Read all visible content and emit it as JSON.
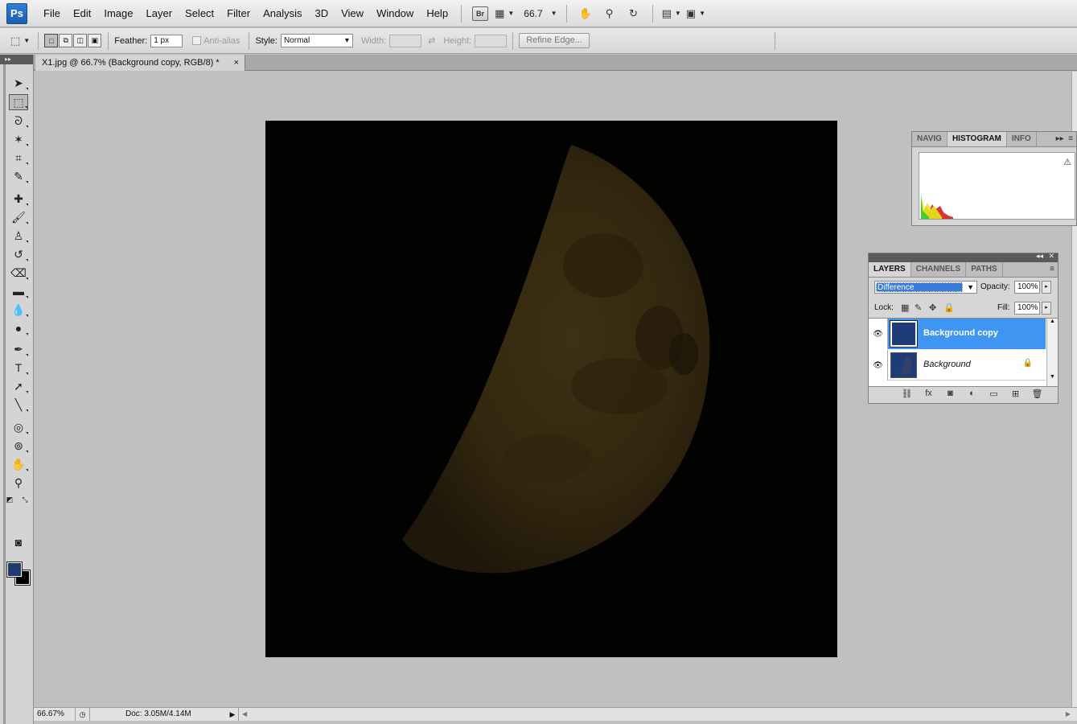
{
  "app": {
    "logo": "Ps"
  },
  "menu": {
    "items": [
      "File",
      "Edit",
      "Image",
      "Layer",
      "Select",
      "Filter",
      "Analysis",
      "3D",
      "View",
      "Window",
      "Help"
    ]
  },
  "appbar": {
    "bridge_label": "Br",
    "zoom": "66.7"
  },
  "options": {
    "feather_label": "Feather:",
    "feather_value": "1 px",
    "antialias_label": "Anti-alias",
    "style_label": "Style:",
    "style_value": "Normal",
    "width_label": "Width:",
    "height_label": "Height:",
    "refine_label": "Refine Edge..."
  },
  "document": {
    "tab_title": "X1.jpg @ 66.7% (Background copy, RGB/8) *",
    "tab_close": "×"
  },
  "status": {
    "zoom": "66.67%",
    "doc_info": "Doc: 3.05M/4.14M"
  },
  "histogram_panel": {
    "tabs": [
      "NAVIG",
      "HISTOGRAM",
      "INFO"
    ],
    "active_tab": 1
  },
  "layers_panel": {
    "tabs": [
      "LAYERS",
      "CHANNELS",
      "PATHS"
    ],
    "blend_mode": "Difference",
    "opacity_label": "Opacity:",
    "opacity_value": "100%",
    "lock_label": "Lock:",
    "fill_label": "Fill:",
    "fill_value": "100%",
    "layers": [
      {
        "name": "Background copy",
        "selected": true,
        "locked": false
      },
      {
        "name": "Background",
        "selected": false,
        "locked": true
      }
    ]
  },
  "colors": {
    "foreground": "#1f3a70",
    "background": "#000000",
    "selection": "#3f96f2"
  }
}
